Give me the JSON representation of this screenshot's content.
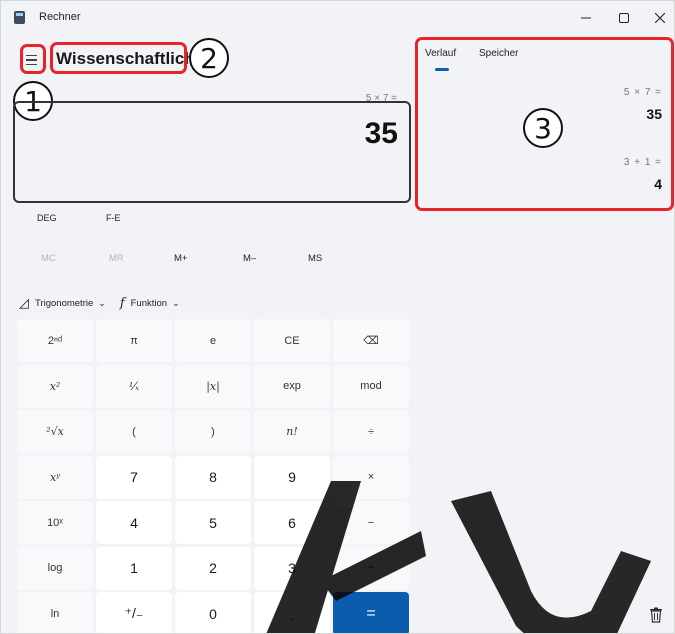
{
  "window": {
    "title": "Rechner"
  },
  "calculator": {
    "mode_title": "Wissenschaftlich",
    "expression": "5 × 7 =",
    "result": "35",
    "angle_mode": "DEG",
    "fe_label": "F-E",
    "memory": [
      "MC",
      "MR",
      "M+",
      "M–",
      "MS"
    ],
    "functions": {
      "trig": "Trigonometrie",
      "func": "Funktion"
    },
    "keys": [
      [
        "2ⁿᵈ",
        "π",
        "e",
        "CE",
        "⌫"
      ],
      [
        "x²",
        "¹⁄ₓ",
        "|x|",
        "exp",
        "mod"
      ],
      [
        "²√x",
        "(",
        ")",
        "n!",
        "÷"
      ],
      [
        "xʸ",
        "7",
        "8",
        "9",
        "×"
      ],
      [
        "10ˣ",
        "4",
        "5",
        "6",
        "−"
      ],
      [
        "log",
        "1",
        "2",
        "3",
        "+"
      ],
      [
        "ln",
        "⁺/₋",
        "0",
        ",",
        "="
      ]
    ]
  },
  "history": {
    "tabs": [
      "Verlauf",
      "Speicher"
    ],
    "entries": [
      {
        "expression": "5  ×  7 =",
        "result": "35"
      },
      {
        "expression": "3  +  1 =",
        "result": "4"
      }
    ]
  },
  "annotations": [
    "1",
    "2",
    "3"
  ],
  "watermark": "AU",
  "colors": {
    "highlight": "#e5252a",
    "accent": "#0b5cad"
  }
}
